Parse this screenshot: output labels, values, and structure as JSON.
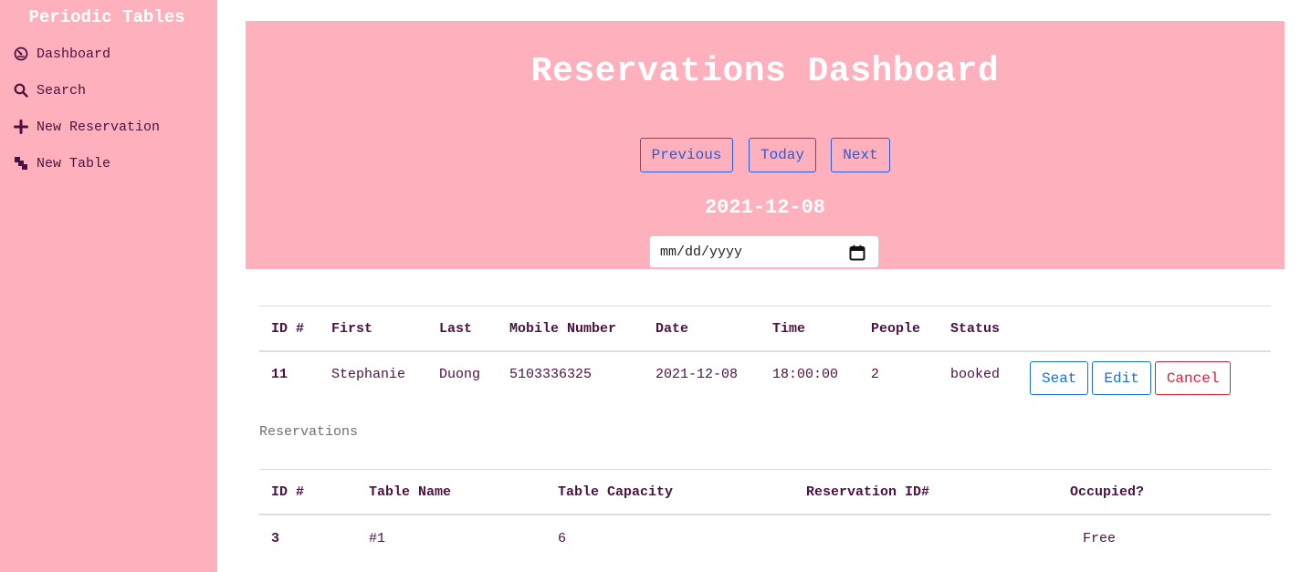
{
  "app": {
    "title": "Periodic Tables"
  },
  "sidebar": {
    "items": [
      {
        "label": "Dashboard",
        "icon": "dashboard-icon"
      },
      {
        "label": "Search",
        "icon": "search-icon"
      },
      {
        "label": "New Reservation",
        "icon": "plus-icon"
      },
      {
        "label": "New Table",
        "icon": "table-icon"
      }
    ]
  },
  "header": {
    "title": "Reservations Dashboard",
    "buttons": {
      "previous": "Previous",
      "today": "Today",
      "next": "Next"
    },
    "current_date": "2021-12-08",
    "date_input": {
      "placeholder": "mm/dd/yyyy"
    }
  },
  "reservations": {
    "columns": [
      "ID #",
      "First",
      "Last",
      "Mobile Number",
      "Date",
      "Time",
      "People",
      "Status"
    ],
    "rows": [
      {
        "id": "11",
        "first": "Stephanie",
        "last": "Duong",
        "mobile": "5103336325",
        "date": "2021-12-08",
        "time": "18:00:00",
        "people": "2",
        "status": "booked",
        "actions": {
          "seat": "Seat",
          "edit": "Edit",
          "cancel": "Cancel"
        }
      }
    ],
    "caption": "Reservations"
  },
  "tables": {
    "columns": [
      "ID #",
      "Table Name",
      "Table Capacity",
      "Reservation ID#",
      "Occupied?"
    ],
    "rows": [
      {
        "id": "3",
        "name": "#1",
        "capacity": "6",
        "reservation_id": "",
        "occupied": "Free"
      }
    ]
  },
  "colors": {
    "sidebar_bg": "#ffb0bd",
    "header_bg": "#ffb0bd",
    "text": "#4a1240",
    "primary": "#2a5bd7",
    "danger": "#d6233a"
  }
}
